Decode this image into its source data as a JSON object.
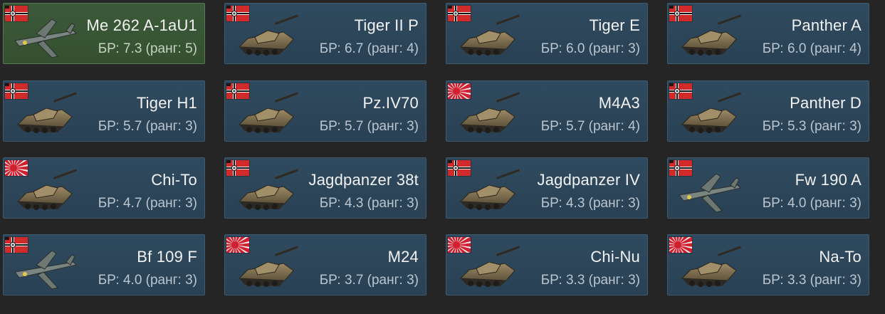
{
  "colors": {
    "background": "#252525",
    "card": "#2c4558",
    "card_selected": "#3a5636",
    "name_text": "#f2f2f2",
    "br_text": "#b9c6d0"
  },
  "vehicles": [
    {
      "name": "Me 262 A-1aU1",
      "br": "БР: 7.3 (ранг: 5)",
      "nation": "germany",
      "kind": "plane",
      "selected": true
    },
    {
      "name": "Tiger II P",
      "br": "БР: 6.7 (ранг: 4)",
      "nation": "germany",
      "kind": "tank",
      "selected": false
    },
    {
      "name": "Tiger E",
      "br": "БР: 6.0 (ранг: 3)",
      "nation": "germany",
      "kind": "tank",
      "selected": false
    },
    {
      "name": "Panther A",
      "br": "БР: 6.0 (ранг: 4)",
      "nation": "germany",
      "kind": "tank",
      "selected": false
    },
    {
      "name": "Tiger H1",
      "br": "БР: 5.7 (ранг: 3)",
      "nation": "germany",
      "kind": "tank",
      "selected": false
    },
    {
      "name": "Pz.IV70",
      "br": "БР: 5.7 (ранг: 3)",
      "nation": "germany",
      "kind": "tank",
      "selected": false
    },
    {
      "name": "M4A3",
      "br": "БР: 5.7 (ранг: 4)",
      "nation": "japan",
      "kind": "tank",
      "selected": false
    },
    {
      "name": "Panther D",
      "br": "БР: 5.3 (ранг: 3)",
      "nation": "germany",
      "kind": "tank",
      "selected": false
    },
    {
      "name": "Chi-To",
      "br": "БР: 4.7 (ранг: 3)",
      "nation": "japan",
      "kind": "tank",
      "selected": false
    },
    {
      "name": "Jagdpanzer 38t",
      "br": "БР: 4.3 (ранг: 3)",
      "nation": "germany",
      "kind": "tank",
      "selected": false
    },
    {
      "name": "Jagdpanzer IV",
      "br": "БР: 4.3 (ранг: 3)",
      "nation": "germany",
      "kind": "tank",
      "selected": false
    },
    {
      "name": "Fw 190 A",
      "br": "БР: 4.0 (ранг: 3)",
      "nation": "germany",
      "kind": "plane",
      "selected": false
    },
    {
      "name": "Bf 109 F",
      "br": "БР: 4.0 (ранг: 3)",
      "nation": "germany",
      "kind": "plane",
      "selected": false
    },
    {
      "name": "M24",
      "br": "БР: 3.7 (ранг: 3)",
      "nation": "japan",
      "kind": "tank",
      "selected": false
    },
    {
      "name": "Chi-Nu",
      "br": "БР: 3.3 (ранг: 3)",
      "nation": "japan",
      "kind": "tank",
      "selected": false
    },
    {
      "name": "Na-To",
      "br": "БР: 3.3 (ранг: 3)",
      "nation": "japan",
      "kind": "tank",
      "selected": false
    }
  ]
}
